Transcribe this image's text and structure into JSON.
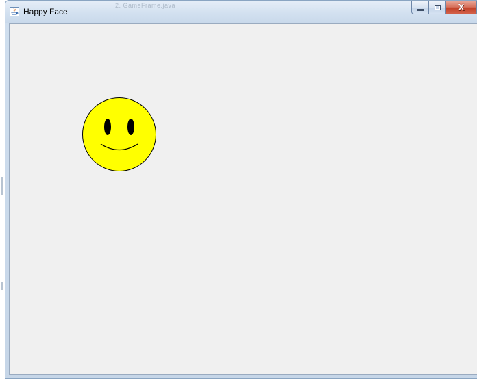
{
  "window": {
    "title": "Happy Face",
    "background_title_ghost": "2.  GameFrame.java"
  },
  "controls": {
    "close_glyph": "X"
  },
  "icons": {
    "app": "java-icon",
    "minimize": "minimize-icon",
    "maximize": "maximize-icon",
    "close": "close-icon"
  },
  "colors": {
    "panel_background": "#f0f0f0",
    "face_fill": "#ffff00",
    "face_outline": "#000000",
    "features": "#000000",
    "close_button": "#c7432a"
  }
}
